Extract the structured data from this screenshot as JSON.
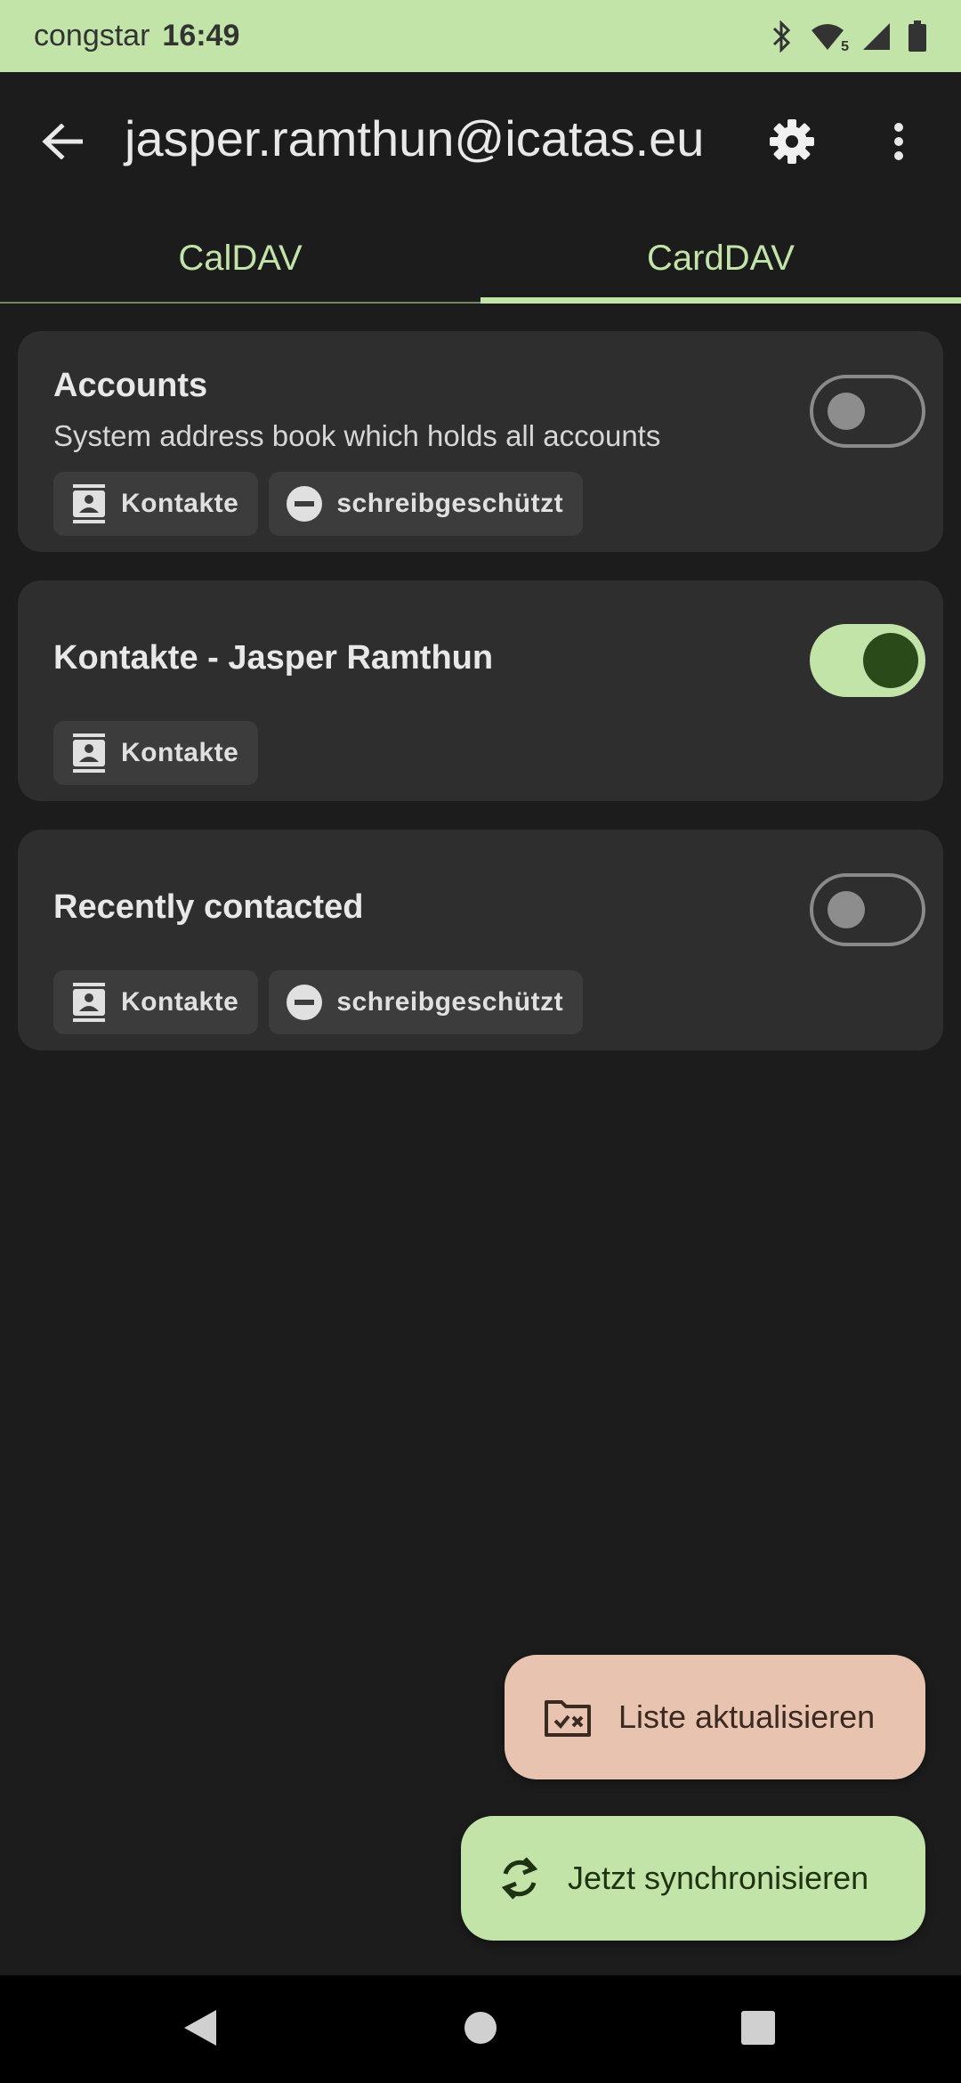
{
  "status_bar": {
    "carrier": "congstar",
    "time": "16:49",
    "icons": [
      "bluetooth-icon",
      "wifi-calling-icon",
      "cell-signal-icon",
      "battery-icon"
    ],
    "wifi_badge": "5"
  },
  "app_bar": {
    "title": "jasper.ramthun@icatas.eu",
    "back_icon": "arrow-back-icon",
    "settings_icon": "gear-icon",
    "more_icon": "more-vert-icon"
  },
  "tabs": [
    {
      "label": "CalDAV",
      "active": false
    },
    {
      "label": "CardDAV",
      "active": true
    }
  ],
  "cards": [
    {
      "title": "Accounts",
      "description": "System address book which holds all accounts",
      "enabled": false,
      "chips": [
        {
          "icon": "contacts-icon",
          "label": "Kontakte"
        },
        {
          "icon": "read-only-icon",
          "label": "schreibgeschützt"
        }
      ]
    },
    {
      "title": "Kontakte - Jasper Ramthun",
      "description": "",
      "enabled": true,
      "chips": [
        {
          "icon": "contacts-icon",
          "label": "Kontakte"
        }
      ]
    },
    {
      "title": "Recently contacted",
      "description": "",
      "enabled": false,
      "chips": [
        {
          "icon": "contacts-icon",
          "label": "Kontakte"
        },
        {
          "icon": "read-only-icon",
          "label": "schreibgeschützt"
        }
      ]
    }
  ],
  "fabs": {
    "refresh_label": "Liste aktualisieren",
    "refresh_icon": "folder-sync-icon",
    "sync_label": "Jetzt synchronisieren",
    "sync_icon": "sync-icon"
  },
  "colors": {
    "accent": "#c3e4a8",
    "background": "#1c1c1c",
    "card": "#2e2e2e",
    "refresh_fab": "#e8c4b0"
  },
  "nav_bar": {
    "icons": [
      "nav-back-icon",
      "nav-home-icon",
      "nav-recents-icon"
    ]
  }
}
